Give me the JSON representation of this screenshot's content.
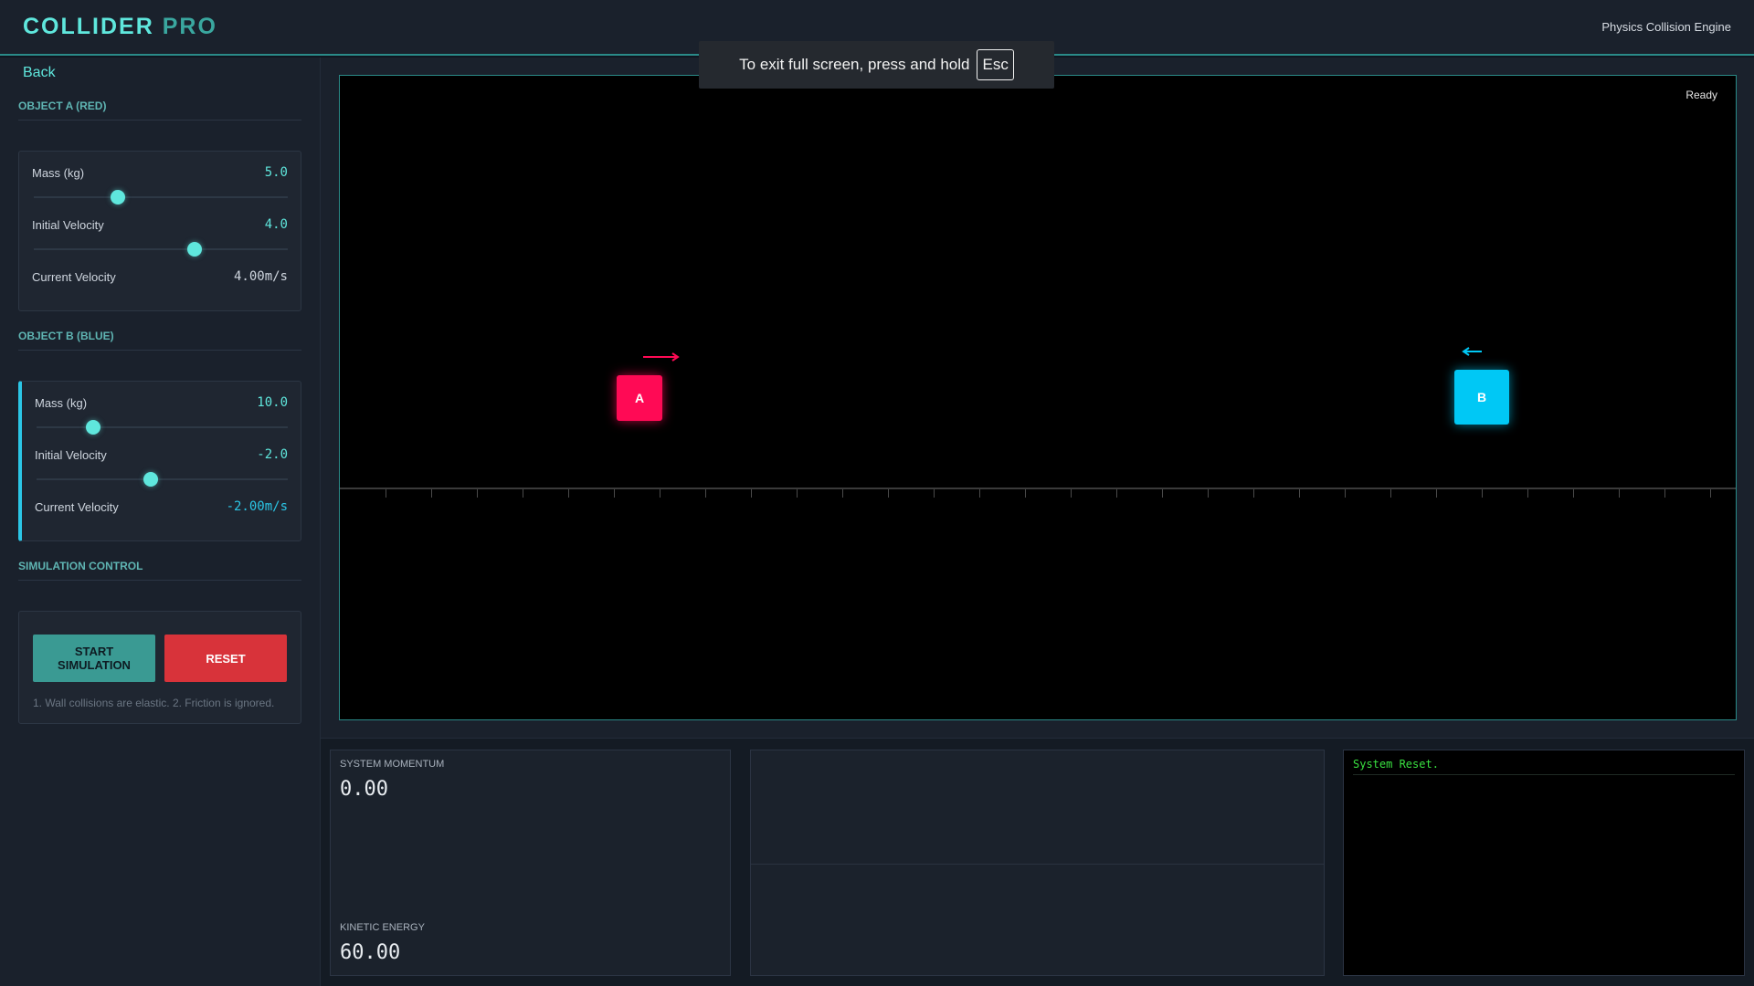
{
  "header": {
    "brand_main": "COLLIDER",
    "brand_accent": "PRO",
    "subtitle": "Physics Collision Engine"
  },
  "fullscreen_notice": {
    "text": "To exit full screen, press and hold",
    "key": "Esc"
  },
  "sidebar": {
    "back_label": "Back",
    "object_a": {
      "title": "OBJECT A (RED)",
      "mass_label": "Mass (kg)",
      "mass_value": "5.0",
      "mass_level": 0.32,
      "velocity_label": "Initial Velocity",
      "velocity_value": "4.0",
      "velocity_level": 0.64,
      "current_label": "Current Velocity",
      "current_value": "4.00m/s"
    },
    "object_b": {
      "title": "OBJECT B (BLUE)",
      "mass_label": "Mass (kg)",
      "mass_value": "10.0",
      "mass_level": 0.21,
      "velocity_label": "Initial Velocity",
      "velocity_value": "-2.0",
      "velocity_level": 0.45,
      "current_label": "Current Velocity",
      "current_value": "-2.00m/s"
    },
    "simulation": {
      "title": "SIMULATION CONTROL",
      "start_label_line1": "START",
      "start_label_line2": "SIMULATION",
      "reset_label": "RESET",
      "note": "1. Wall collisions are elastic. 2. Friction is ignored."
    }
  },
  "canvas": {
    "status": "Ready",
    "object_a_label": "A",
    "object_b_label": "B",
    "colors": {
      "object_a": "#ff0a55",
      "object_b": "#00c8f5",
      "accent": "#5fe7dd"
    }
  },
  "stats": {
    "momentum_label": "SYSTEM MOMENTUM",
    "momentum_value": "0.00",
    "energy_label": "KINETIC ENERGY",
    "energy_value": "60.00"
  },
  "log": {
    "lines": [
      "System Reset."
    ]
  }
}
